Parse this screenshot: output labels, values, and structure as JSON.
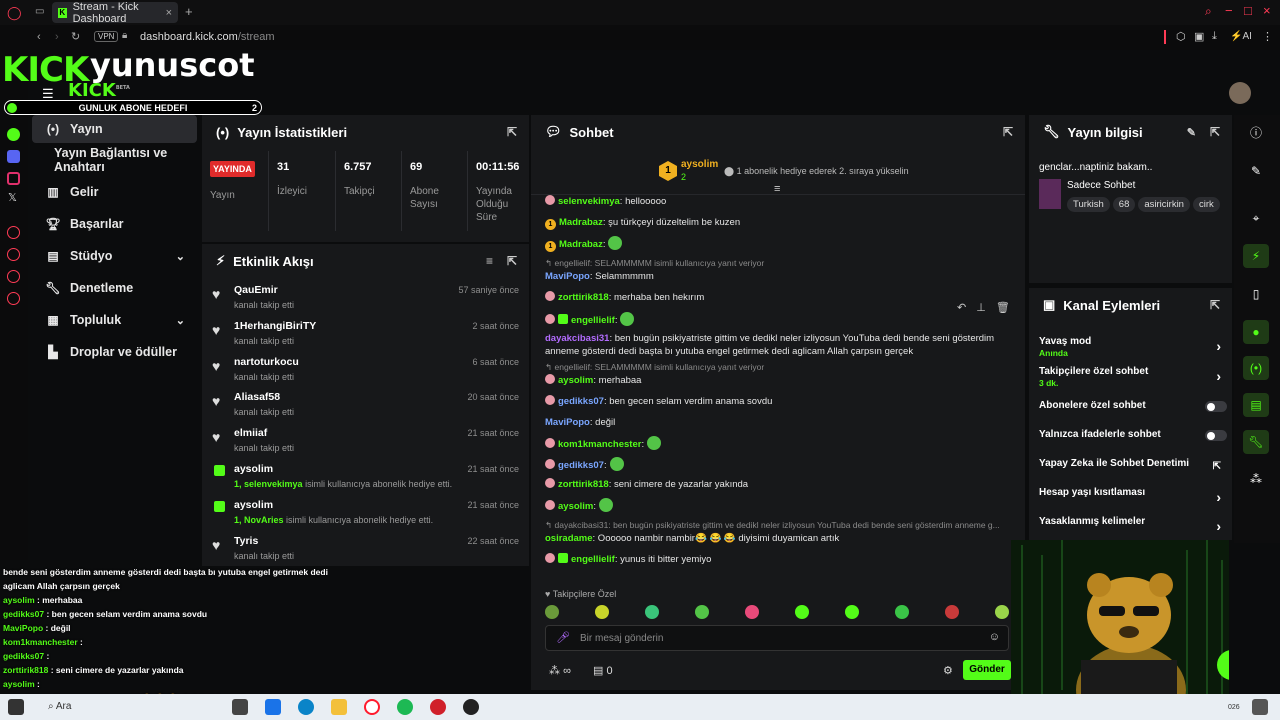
{
  "browser": {
    "tab_title": "Stream - Kick Dashboard",
    "vpn": "VPN",
    "url_domain": "dashboard.kick.com",
    "url_path": "/stream",
    "ai_label": "AI"
  },
  "overlay": {
    "logo_text": "KICK",
    "channel_name": "yunuscot",
    "logo_small": "KICK",
    "beta": "BETA",
    "goal_label": "GUNLUK ABONE HEDEFI",
    "goal_count": "2"
  },
  "nav": {
    "items": [
      {
        "label": "Yayın",
        "icon": "broadcast-icon"
      },
      {
        "label": "Yayın Bağlantısı ve Anahtarı",
        "icon": ""
      },
      {
        "label": "Gelir",
        "icon": "chart-icon"
      },
      {
        "label": "Başarılar",
        "icon": "trophy-icon"
      },
      {
        "label": "Stüdyo",
        "icon": "studio-icon"
      },
      {
        "label": "Denetleme",
        "icon": "wrench-icon"
      },
      {
        "label": "Topluluk",
        "icon": "community-icon"
      },
      {
        "label": "Droplar ve ödüller",
        "icon": "drops-icon"
      }
    ]
  },
  "stats": {
    "title": "Yayın İstatistikleri",
    "live_badge": "YAYINDA",
    "items": [
      {
        "value": "",
        "label": "Yayın"
      },
      {
        "value": "31",
        "label": "İzleyici"
      },
      {
        "value": "6.757",
        "label": "Takipçi"
      },
      {
        "value": "69",
        "label": "Abone Sayısı"
      },
      {
        "value": "00:11:56",
        "label": "Yayında Olduğu Süre"
      }
    ]
  },
  "activity": {
    "title": "Etkinlik Akışı",
    "events": [
      {
        "name": "QauEmir",
        "desc": "kanalı takip etti",
        "highlight": "",
        "time": "57 saniye önce",
        "type": "follow"
      },
      {
        "name": "1HerhangiBiriTY",
        "desc": "kanalı takip etti",
        "highlight": "",
        "time": "2 saat önce",
        "type": "follow"
      },
      {
        "name": "nartoturkocu",
        "desc": "kanalı takip etti",
        "highlight": "",
        "time": "6 saat önce",
        "type": "follow"
      },
      {
        "name": "Aliasaf58",
        "desc": "kanalı takip etti",
        "highlight": "",
        "time": "20 saat önce",
        "type": "follow"
      },
      {
        "name": "elmiiaf",
        "desc": "kanalı takip etti",
        "highlight": "",
        "time": "21 saat önce",
        "type": "follow"
      },
      {
        "name": "aysolim",
        "desc": " isimli kullanıcıya abonelik hediye etti.",
        "highlight": "1, selenvekimya",
        "time": "21 saat önce",
        "type": "gift"
      },
      {
        "name": "aysolim",
        "desc": " isimli kullanıcıya abonelik hediye etti.",
        "highlight": "1, NovAries",
        "time": "21 saat önce",
        "type": "gift"
      },
      {
        "name": "Tyris",
        "desc": "kanalı takip etti",
        "highlight": "",
        "time": "22 saat önce",
        "type": "follow"
      }
    ]
  },
  "chat": {
    "title": "Sohbet",
    "pinned_user": "aysolim",
    "pinned_count": "2",
    "pinned_text": "1 abonelik hediye ederek 2. sıraya yükselin",
    "reply_label": "engellielif: SELAMMMMM isimli kullanıcıya yanıt veriyor",
    "messages": [
      {
        "user": "selenvekimya",
        "text": " hellooooo",
        "color": "#53fc18",
        "badge": "avatar",
        "reply": ""
      },
      {
        "user": "Madrabaz",
        "text": " şu türkçeyi düzeltelim be kuzen",
        "color": "#53fc18",
        "badge": "sub1",
        "reply": ""
      },
      {
        "user": "Madrabaz",
        "text": "",
        "color": "#53fc18",
        "badge": "sub1",
        "reply": "",
        "emote": true
      },
      {
        "user": "MaviPopo",
        "text": " Selammmmm",
        "color": "#7aa6ff",
        "badge": "",
        "reply": "engellielif: SELAMMMMM isimli kullanıcıya yanıt veriyor"
      },
      {
        "user": "zorttirik818",
        "text": " merhaba ben hekırım",
        "color": "#53fc18",
        "badge": "avatar",
        "reply": ""
      },
      {
        "user": "engellielif",
        "text": "",
        "color": "#53fc18",
        "badge": "avatar-gift",
        "reply": "",
        "emote": true
      },
      {
        "user": "dayakcibasi31",
        "text": " ben bugün psikiyatriste gittim ve dedikl neler izliyosun YouTuba dedi bende seni gösterdim anneme gösterdi dedi başta bı yutuba engel getirmek dedi aglicam Allah çarpsın gerçek",
        "color": "#b36cff",
        "badge": "",
        "reply": ""
      },
      {
        "user": "aysolim",
        "text": " merhabaa",
        "color": "#53fc18",
        "badge": "avatar",
        "reply": "engellielif: SELAMMMMM isimli kullanıcıya yanıt veriyor"
      },
      {
        "user": "gedikks07",
        "text": " ben gecen selam verdim anama sovdu",
        "color": "#7aa6ff",
        "badge": "avatar",
        "reply": ""
      },
      {
        "user": "MaviPopo",
        "text": " değil",
        "color": "#7aa6ff",
        "badge": "",
        "reply": ""
      },
      {
        "user": "kom1kmanchester",
        "text": "",
        "color": "#53fc18",
        "badge": "avatar",
        "reply": "",
        "emote": true
      },
      {
        "user": "gedikks07",
        "text": "",
        "color": "#7aa6ff",
        "badge": "avatar",
        "reply": "",
        "emote": true
      },
      {
        "user": "zorttirik818",
        "text": " seni cimere de yazarlar yakında",
        "color": "#53fc18",
        "badge": "avatar",
        "reply": ""
      },
      {
        "user": "aysolim",
        "text": "",
        "color": "#53fc18",
        "badge": "avatar",
        "reply": "",
        "emote": true
      },
      {
        "user": "osiradame",
        "text": " Oooooo nambir nambir😂 😂 😂 diyisimi duyamican artık",
        "color": "#53fc18",
        "badge": "",
        "reply": "dayakcibasi31: ben bugün psikiyatriste gittim ve dedikl neler izliyosun YouTuba dedi bende seni gösterdim anneme g..."
      },
      {
        "user": "engellielif",
        "text": " yunus iti bitter yemiyo",
        "color": "#53fc18",
        "badge": "avatar-gift",
        "reply": ""
      }
    ],
    "followers_only": "Takipçilere Özel",
    "input_placeholder": "Bir mesaj gönderin",
    "infinity": "∞",
    "count": "0",
    "send": "Gönder"
  },
  "stream_info": {
    "title": "Yayın bilgisi",
    "stream_title": "genclar...naptiniz bakam..",
    "category": "Sadece Sohbet",
    "tags": [
      "Turkish",
      "68",
      "asiricirkin",
      "cirk"
    ]
  },
  "channel_actions": {
    "title": "Kanal Eylemleri",
    "items": [
      {
        "label": "Yavaş mod",
        "sub": "Anında",
        "control": "arrow"
      },
      {
        "label": "Takipçilere özel sohbet",
        "sub": "3 dk.",
        "control": "arrow"
      },
      {
        "label": "Abonelere özel sohbet",
        "sub": "",
        "control": "toggle"
      },
      {
        "label": "Yalnızca ifadelerle sohbet",
        "sub": "",
        "control": "toggle"
      },
      {
        "label": "Yapay Zeka ile Sohbet Denetimi",
        "sub": "",
        "control": "external"
      },
      {
        "label": "Hesap yaşı kısıtlaması",
        "sub": "",
        "control": "arrow"
      },
      {
        "label": "Yasaklanmış kelimeler",
        "sub": "",
        "control": "arrow"
      }
    ]
  },
  "overlay_chat": [
    {
      "user": "",
      "text": "bende seni gösterdim anneme gösterdi dedi başta bı yutuba engel getirmek dedi"
    },
    {
      "user": "",
      "text": "aglicam Allah çarpsın gerçek"
    },
    {
      "user": "aysolim",
      "text": " : merhabaa"
    },
    {
      "user": "gedikks07",
      "text": " : ben gecen selam verdim anama sovdu"
    },
    {
      "user": "MaviPopo",
      "text": " : değil"
    },
    {
      "user": "kom1kmanchester",
      "text": " :"
    },
    {
      "user": "gedikks07",
      "text": " :"
    },
    {
      "user": "zorttirik818",
      "text": " : seni cimere de yazarlar yakında"
    },
    {
      "user": "aysolim",
      "text": " :"
    },
    {
      "user": "osiradame",
      "text": " : Ooooo nambir nambir😂 😂 😂 diyisimi duyamican artık"
    },
    {
      "user": "engellielif",
      "text": " : yunus iti bitter yemiyo"
    }
  ],
  "taskbar": {
    "search": "Ara",
    "year": "026"
  },
  "colors": {
    "accent": "#53fc18",
    "panel": "#17181a",
    "live": "#e02b2b"
  }
}
